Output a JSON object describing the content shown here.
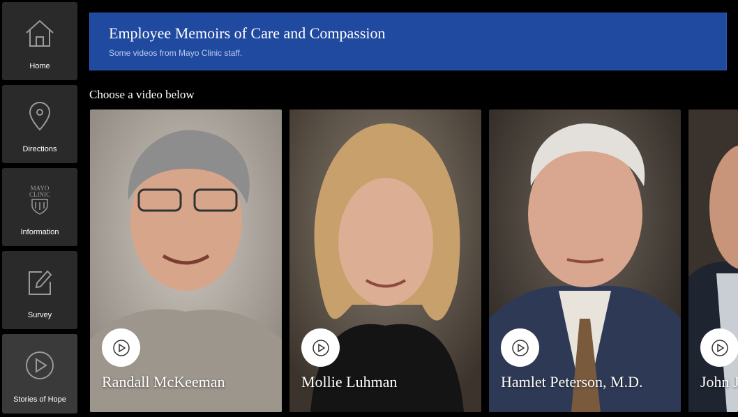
{
  "sidebar": {
    "items": [
      {
        "label": "Home",
        "icon": "home-icon"
      },
      {
        "label": "Directions",
        "icon": "location-pin-icon"
      },
      {
        "label": "Information",
        "icon": "mayo-clinic-logo"
      },
      {
        "label": "Survey",
        "icon": "edit-icon"
      },
      {
        "label": "Stories of Hope",
        "icon": "play-circle-icon"
      }
    ]
  },
  "banner": {
    "title": "Employee Memoirs of Care and Compassion",
    "subtitle": "Some videos from Mayo Clinic staff."
  },
  "prompt": "Choose a video below",
  "logo_text": [
    "MAYO",
    "CLINIC"
  ],
  "videos": [
    {
      "name": "Randall McKeeman"
    },
    {
      "name": "Mollie Luhman"
    },
    {
      "name": "Hamlet Peterson, M.D."
    },
    {
      "name": "John J"
    }
  ],
  "colors": {
    "banner": "#1f4aa0",
    "tile": "#2a2a2a",
    "tile_active": "#3a3a3a",
    "background": "#000000"
  }
}
